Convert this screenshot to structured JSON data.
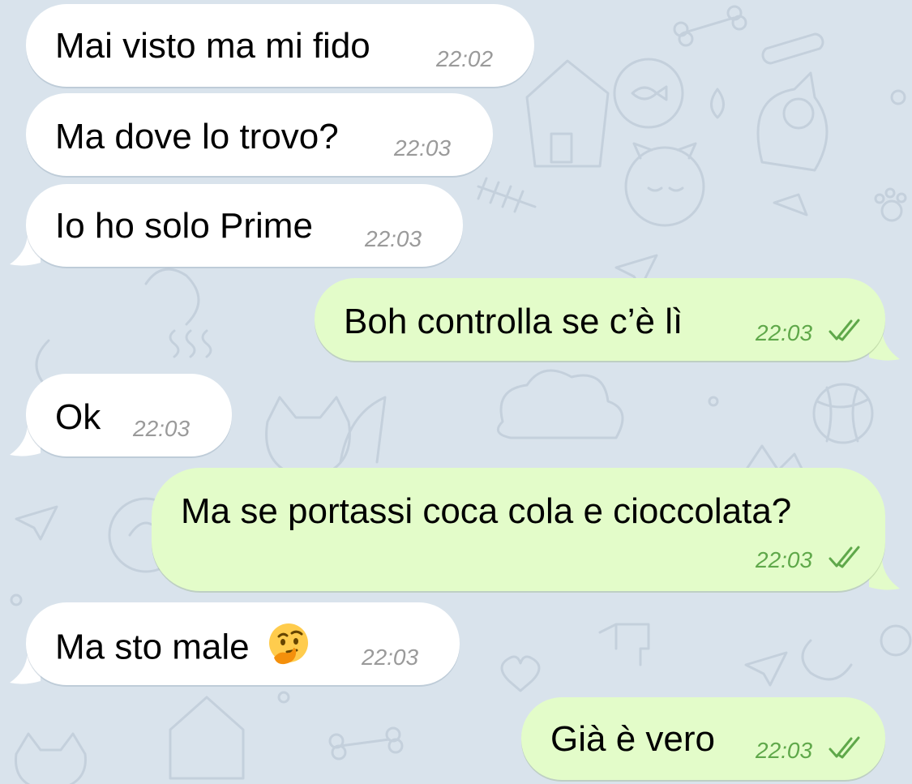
{
  "colors": {
    "background": "#d9e3ec",
    "incoming_bubble": "#ffffff",
    "outgoing_bubble": "#e3fcc9",
    "outgoing_time": "#5fa84a",
    "incoming_time": "#9a9a9a"
  },
  "messages": [
    {
      "direction": "incoming",
      "text": "Mai visto ma mi fido",
      "time": "22:02"
    },
    {
      "direction": "incoming",
      "text": "Ma dove lo trovo?",
      "time": "22:03"
    },
    {
      "direction": "incoming",
      "text": "Io ho solo Prime",
      "time": "22:03"
    },
    {
      "direction": "outgoing",
      "text": "Boh controlla se c’è lì",
      "time": "22:03",
      "status": "read-double-check-icon"
    },
    {
      "direction": "incoming",
      "text": "Ok",
      "time": "22:03"
    },
    {
      "direction": "outgoing",
      "text": "Ma se portassi coca cola e cioccolata?",
      "time": "22:03",
      "status": "read-double-check-icon"
    },
    {
      "direction": "incoming",
      "text": "Ma sto male",
      "time": "22:03",
      "emoji": "thinking-face-emoji"
    },
    {
      "direction": "outgoing",
      "text": "Già è vero",
      "time": "22:03",
      "status": "read-double-check-icon"
    }
  ]
}
